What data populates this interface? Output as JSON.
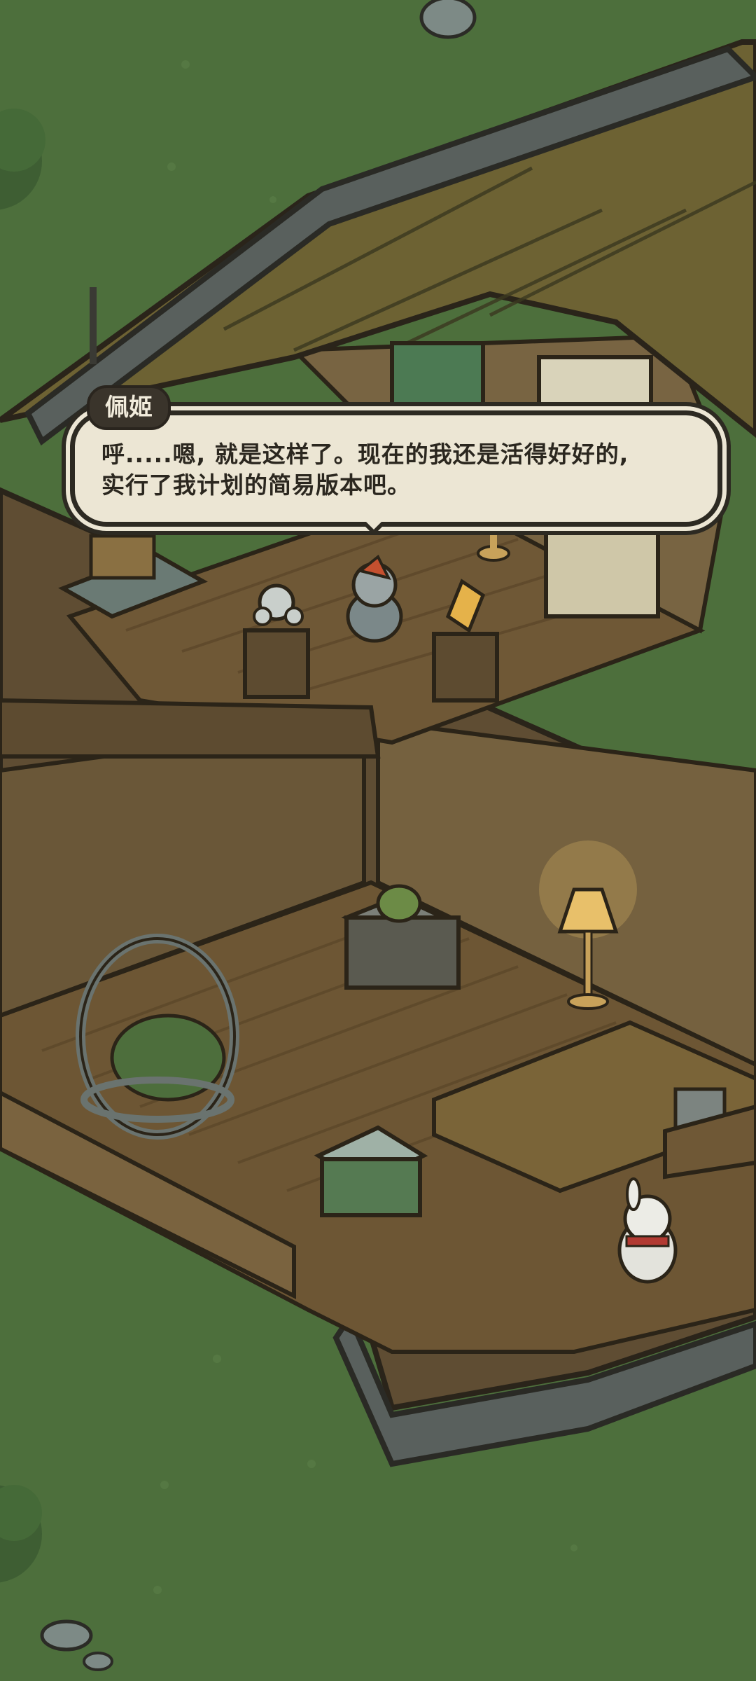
{
  "dialogue": {
    "speaker": "佩姬",
    "line1": "呼.....嗯, 就是这样了。现在的我还是活得好好的,",
    "line2": "实行了我计划的简易版本吧。"
  },
  "scene": {
    "items": [
      "hanging-egg-chair",
      "floor-lamp",
      "side-table",
      "kettle-on-cabinet",
      "gramophone",
      "retro-robot-figure",
      "desk-with-books",
      "cash-register"
    ],
    "characters": [
      "peggy-rabbit-knitting",
      "white-rabbit-red-scarf"
    ]
  }
}
